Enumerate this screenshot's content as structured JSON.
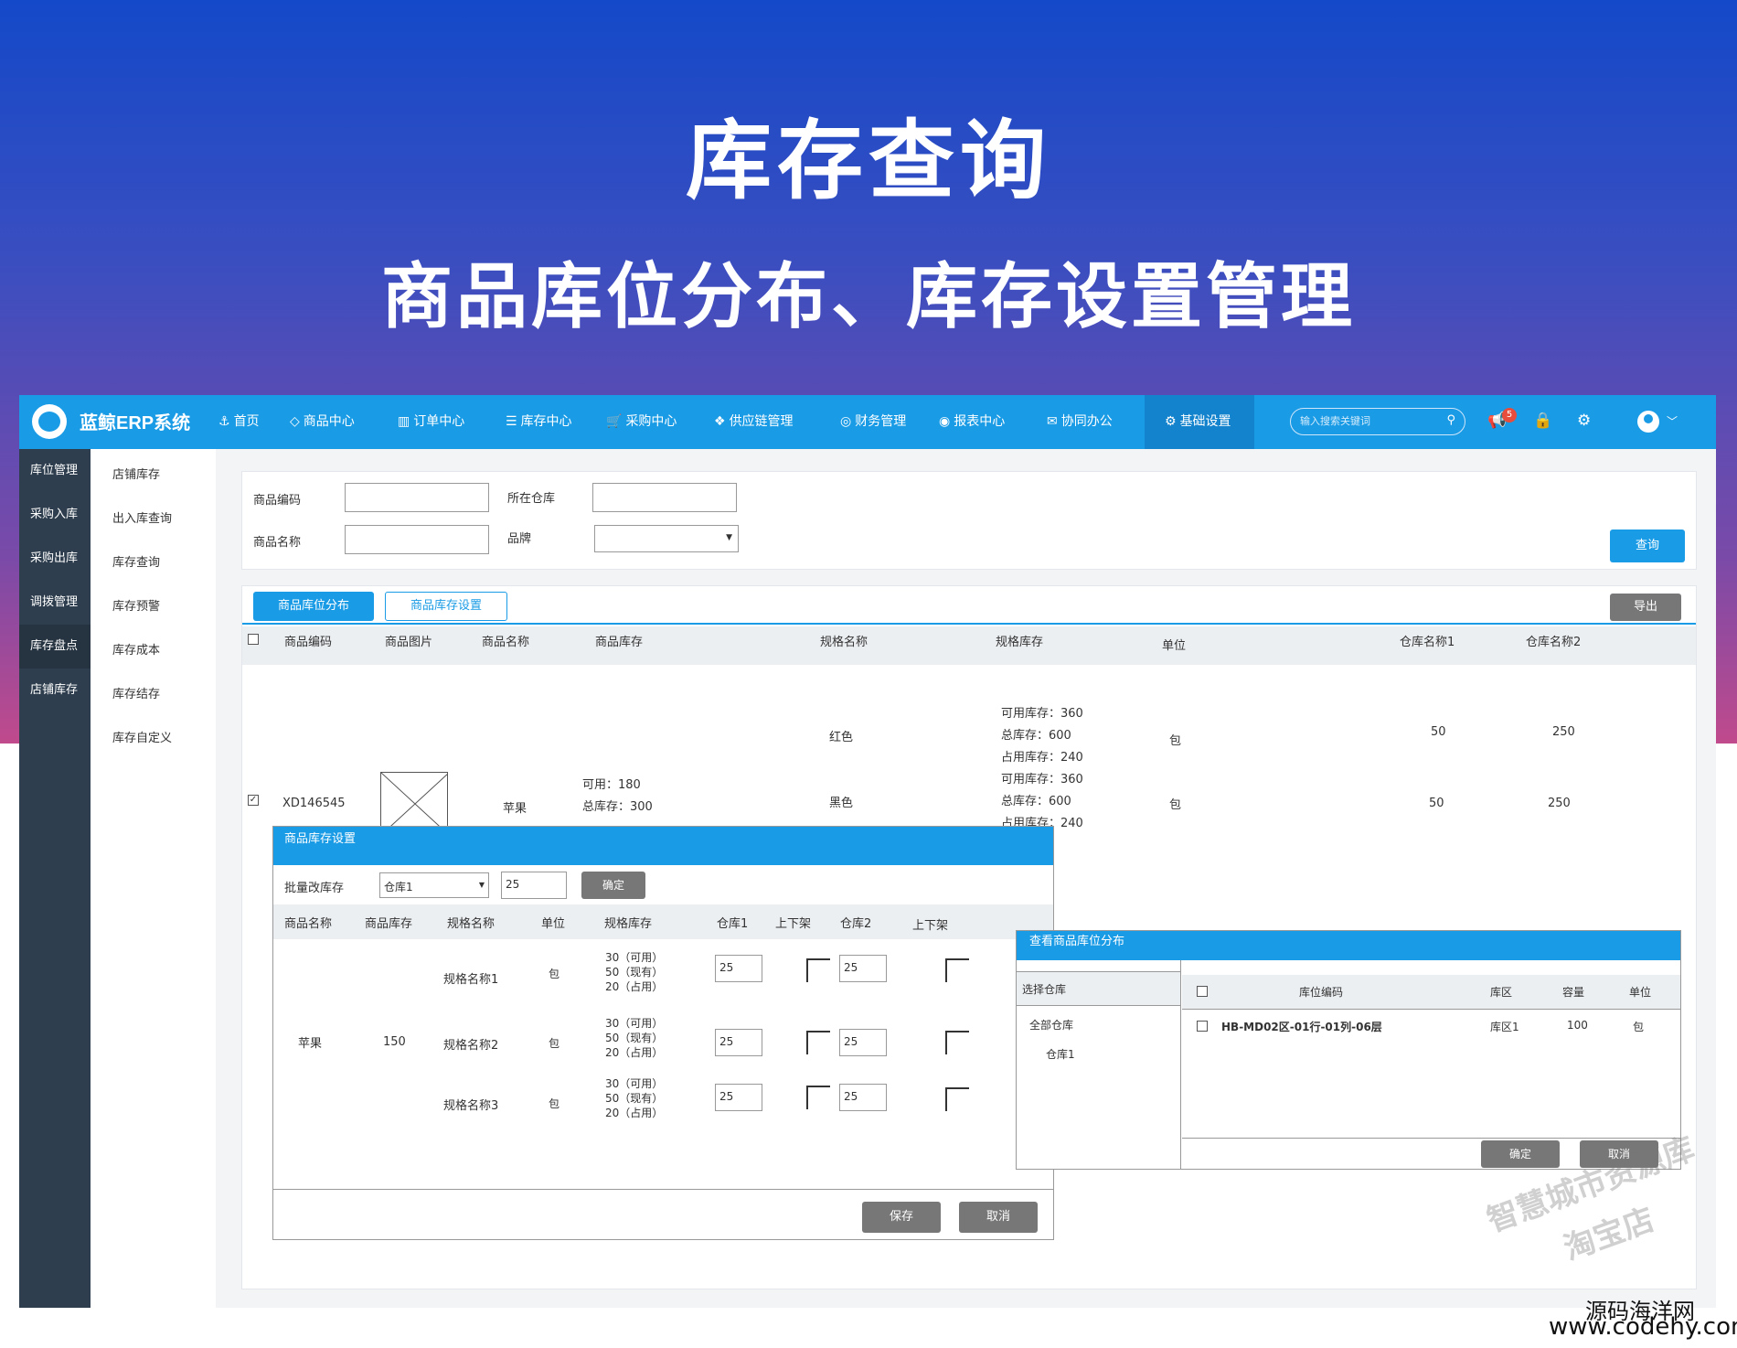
{
  "banner": {
    "title": "库存查询",
    "subtitle": "商品库位分布、库存设置管理"
  },
  "app": {
    "brand": "蓝鲸ERP系统"
  },
  "nav": [
    "首页",
    "商品中心",
    "订单中心",
    "库存中心",
    "采购中心",
    "供应链管理",
    "财务管理",
    "报表中心",
    "协同办公",
    "基础设置"
  ],
  "header": {
    "search_placeholder": "输入搜索关键词",
    "notice_count": "5"
  },
  "sidebar": [
    "库位管理",
    "采购入库",
    "采购出库",
    "调拨管理",
    "库存盘点",
    "店铺库存"
  ],
  "submenu": [
    "店铺库存",
    "出入库查询",
    "库存查询",
    "库存预警",
    "库存成本",
    "库存结存",
    "库存自定义"
  ],
  "filters": {
    "code_label": "商品编码",
    "name_label": "商品名称",
    "warehouse_label": "所在仓库",
    "brand_label": "品牌",
    "query": "查询"
  },
  "tabs": {
    "tab1": "商品库位分布",
    "tab2": "商品库存设置",
    "export": "导出"
  },
  "table": {
    "headers": [
      "商品编码",
      "商品图片",
      "商品名称",
      "商品库存",
      "规格名称",
      "规格库存",
      "单位",
      "仓库名称1",
      "仓库名称2"
    ],
    "rows": [
      {
        "spec": "红色",
        "stock": [
          "可用库存：360",
          "总库存：600",
          "占用库存：240"
        ],
        "unit": "包",
        "w1": "50",
        "w2": "250"
      },
      {
        "code": "XD146545",
        "name": "苹果",
        "avail": "可用：180",
        "total": "总库存：300",
        "spec": "黑色",
        "stock": [
          "可用库存：360",
          "总库存：600",
          "占用库存：240"
        ],
        "unit": "包",
        "w1": "50",
        "w2": "250"
      }
    ]
  },
  "modal1": {
    "title": "商品库存设置",
    "batch_label": "批量改库存",
    "warehouse_sel": "仓库1",
    "qty": "25",
    "confirm": "确定",
    "headers": [
      "商品名称",
      "商品库存",
      "规格名称",
      "单位",
      "规格库存",
      "仓库1",
      "上下架",
      "仓库2",
      "上下架"
    ],
    "product": "苹果",
    "stock": "150",
    "specs": [
      {
        "name": "规格名称1",
        "unit": "包",
        "s1": "30（可用）",
        "s2": "50（现有）",
        "s3": "20（占用）",
        "w1": "25",
        "w2": "25"
      },
      {
        "name": "规格名称2",
        "unit": "包",
        "s1": "30（可用）",
        "s2": "50（现有）",
        "s3": "20（占用）",
        "w1": "25",
        "w2": "25"
      },
      {
        "name": "规格名称3",
        "unit": "包",
        "s1": "30（可用）",
        "s2": "50（现有）",
        "s3": "20（占用）",
        "w1": "25",
        "w2": "25"
      }
    ],
    "save": "保存",
    "cancel": "取消"
  },
  "modal2": {
    "title": "查看商品库位分布",
    "select_label": "选择仓库",
    "all": "全部仓库",
    "wh1": "仓库1",
    "headers": [
      "库位编码",
      "库区",
      "容量",
      "单位"
    ],
    "row": {
      "code": "HB-MD02区-01行-01列-06层",
      "zone": "库区1",
      "cap": "100",
      "unit": "包"
    },
    "confirm": "确定",
    "cancel": "取消"
  },
  "watermark": {
    "line1": "智慧城市资源库",
    "line2": "淘宝店"
  },
  "footer": {
    "cn": "源码海洋网",
    "url": "www.codehy.com"
  }
}
